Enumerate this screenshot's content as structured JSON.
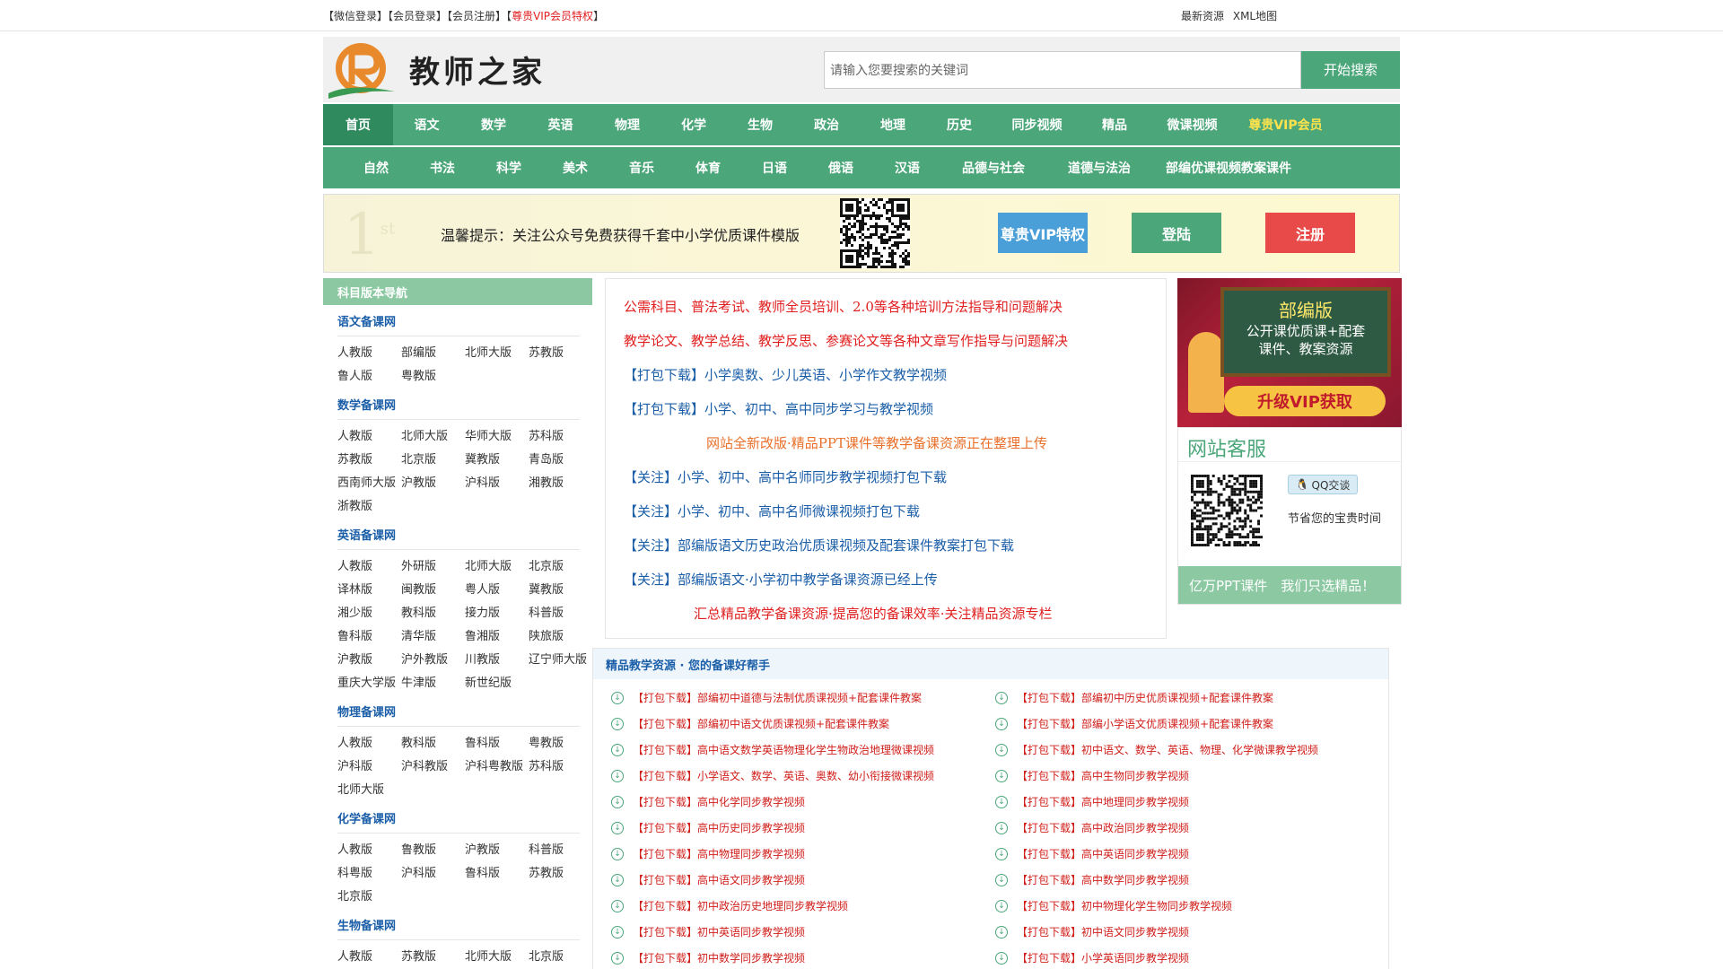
{
  "topbar": {
    "wechat_login": "【微信登录】",
    "member_login": "【会员登录】",
    "member_register": "【会员注册】",
    "vip_prefix": "【",
    "vip": "尊贵VIP会员特权",
    "vip_suffix": "】",
    "latest": "最新资源",
    "sitemap": "XML地图"
  },
  "header": {
    "logo_text": "教师之家",
    "search_placeholder": "请输入您要搜索的关键词",
    "search_button": "开始搜索"
  },
  "nav1": [
    "首页",
    "语文",
    "数学",
    "英语",
    "物理",
    "化学",
    "生物",
    "政治",
    "地理",
    "历史",
    "同步视频",
    "精品",
    "微课视频",
    "尊贵VIP会员"
  ],
  "nav2": [
    "自然",
    "书法",
    "科学",
    "美术",
    "音乐",
    "体育",
    "日语",
    "俄语",
    "汉语",
    "品德与社会",
    "道德与法治",
    "部编优课视频教案课件"
  ],
  "banner": {
    "first": "1",
    "first_sup": "st",
    "notice": "温馨提示：关注公众号免费获得千套中小学优质课件模版",
    "vip_button": "尊贵VIP特权",
    "login_button": "登陆",
    "register_button": "注册"
  },
  "sidebar": {
    "head": "科目版本导航",
    "sections": [
      {
        "title": "语文备课网",
        "items": [
          "人教版",
          "部编版",
          "北师大版",
          "苏教版",
          "鲁人版",
          "粤教版"
        ]
      },
      {
        "title": "数学备课网",
        "items": [
          "人教版",
          "北师大版",
          "华师大版",
          "苏科版",
          "苏教版",
          "北京版",
          "冀教版",
          "青岛版",
          "西南师大版",
          "沪教版",
          "沪科版",
          "湘教版",
          "浙教版"
        ]
      },
      {
        "title": "英语备课网",
        "items": [
          "人教版",
          "外研版",
          "北师大版",
          "北京版",
          "译林版",
          "闽教版",
          "粤人版",
          "冀教版",
          "湘少版",
          "教科版",
          "接力版",
          "科普版",
          "鲁科版",
          "清华版",
          "鲁湘版",
          "陕旅版",
          "沪教版",
          "沪外教版",
          "川教版",
          "辽宁师大版",
          "重庆大学版",
          "牛津版",
          "新世纪版"
        ]
      },
      {
        "title": "物理备课网",
        "items": [
          "人教版",
          "教科版",
          "鲁科版",
          "粤教版",
          "沪科版",
          "沪科教版",
          "沪科粤教版",
          "苏科版",
          "北师大版"
        ]
      },
      {
        "title": "化学备课网",
        "items": [
          "人教版",
          "鲁教版",
          "沪教版",
          "科普版",
          "科粤版",
          "沪科版",
          "鲁科版",
          "苏教版",
          "北京版"
        ]
      },
      {
        "title": "生物备课网",
        "items": [
          "人教版",
          "苏教版",
          "北师大版",
          "北京版"
        ]
      }
    ]
  },
  "notices": [
    {
      "text": "公需科目、普法考试、教师全员培训、2.0等各种培训方法指导和问题解决",
      "color": "#e02020"
    },
    {
      "text": "教学论文、教学总结、教学反思、参赛论文等各种文章写作指导与问题解决",
      "color": "#e02020"
    },
    {
      "text": "【打包下载】小学奥数、少儿英语、小学作文教学视频",
      "color": "#1b5ea8"
    },
    {
      "text": "【打包下载】小学、初中、高中同步学习与教学视频",
      "color": "#1b5ea8"
    },
    {
      "text": "网站全新改版·精品PPT课件等教学备课资源正在整理上传",
      "color": "#e8702a"
    },
    {
      "text": "【关注】小学、初中、高中名师同步教学视频打包下载",
      "color": "#1b5ea8"
    },
    {
      "text": "【关注】小学、初中、高中名师微课视频打包下载",
      "color": "#1b5ea8"
    },
    {
      "text": "【关注】部编版语文历史政治优质课视频及配套课件教案打包下载",
      "color": "#1b5ea8"
    },
    {
      "text": "【关注】部编版语文·小学初中教学备课资源已经上传",
      "color": "#1b5ea8"
    },
    {
      "text": "汇总精品教学备课资源·提高您的备课效率·关注精品资源专栏",
      "color": "#e02020"
    }
  ],
  "ad": {
    "title": "部编版",
    "line1": "公开课优质课+配套",
    "line2": "课件、教案资源",
    "upgrade": "升级VIP获取"
  },
  "kefu": {
    "title": "网站客服",
    "qq": "QQ交谈",
    "save_time": "节省您的宝贵时间",
    "bar": "亿万PPT课件　我们只选精品！"
  },
  "resources": {
    "head": "精品教学资源 · 您的备课好帮手",
    "items": [
      "【打包下载】部编初中道德与法制优质课视频+配套课件教案",
      "【打包下载】部编初中历史优质课视频+配套课件教案",
      "【打包下载】部编初中语文优质课视频+配套课件教案",
      "【打包下载】部编小学语文优质课视频+配套课件教案",
      "【打包下载】高中语文数学英语物理化学生物政治地理微课视频",
      "【打包下载】初中语文、数学、英语、物理、化学微课教学视频",
      "【打包下载】小学语文、数学、英语、奥数、幼小衔接微课视频",
      "【打包下载】高中生物同步教学视频",
      "【打包下载】高中化学同步教学视频",
      "【打包下载】高中地理同步教学视频",
      "【打包下载】高中历史同步教学视频",
      "【打包下载】高中政治同步教学视频",
      "【打包下载】高中物理同步教学视频",
      "【打包下载】高中英语同步教学视频",
      "【打包下载】高中语文同步教学视频",
      "【打包下载】高中数学同步教学视频",
      "【打包下载】初中政治历史地理同步教学视频",
      "【打包下载】初中物理化学生物同步教学视频",
      "【打包下载】初中英语同步教学视频",
      "【打包下载】初中语文同步教学视频",
      "【打包下载】初中数学同步教学视频",
      "【打包下载】小学英语同步教学视频"
    ]
  },
  "colors": {
    "brand_green": "#4ba67a",
    "light_green": "#8cc9a3",
    "red": "#e02020",
    "blue_link": "#1b5ea8"
  }
}
